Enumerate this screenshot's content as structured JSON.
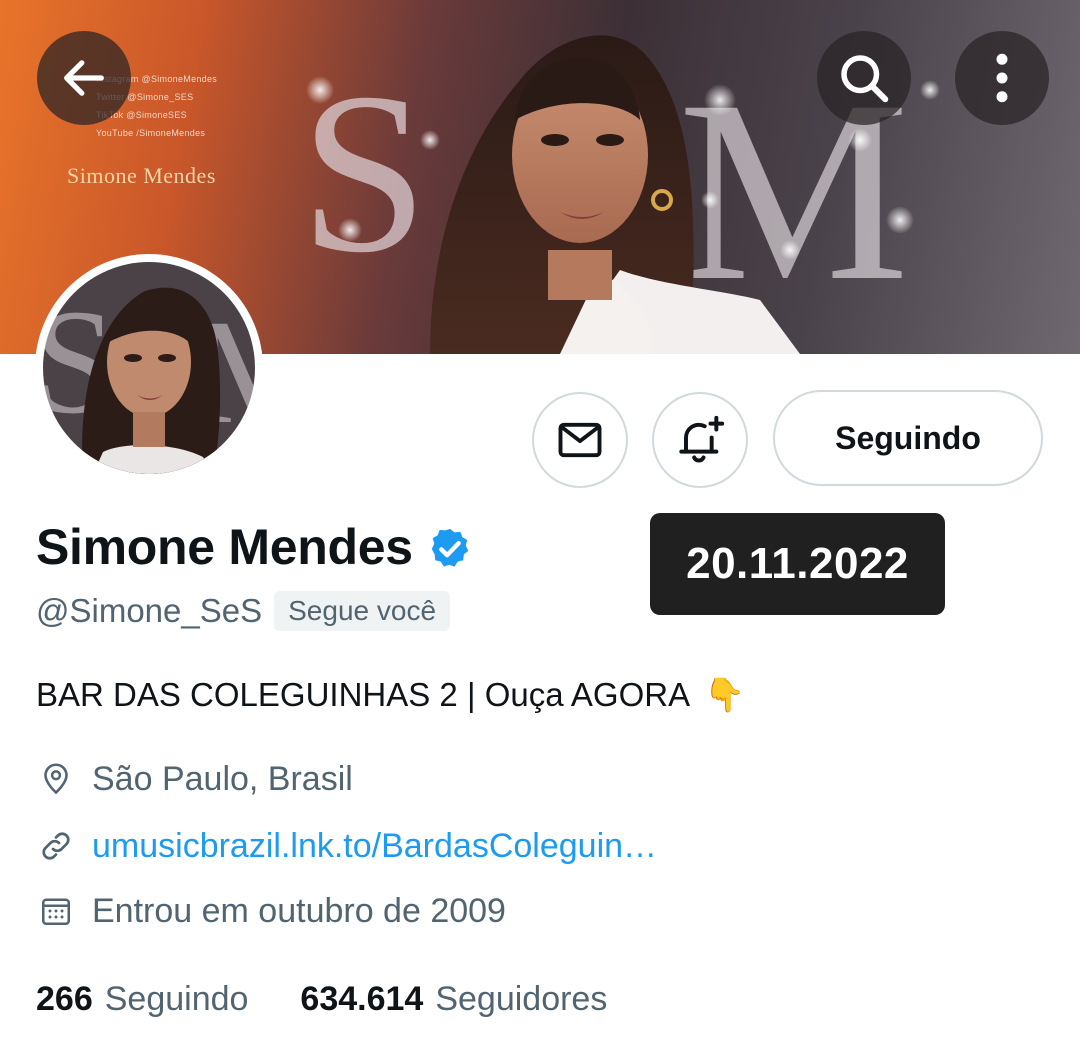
{
  "banner": {
    "socials": [
      "Instagram @SimoneMendes",
      "Twitter @Simone_SES",
      "TikTok @SimoneSES",
      "YouTube /SimoneMendes"
    ],
    "signature": "Simone Mendes",
    "monogram": "SM"
  },
  "toolbar": {
    "back_icon": "arrow-left-icon",
    "search_icon": "search-icon",
    "more_icon": "more-vertical-icon"
  },
  "actions": {
    "message_icon": "envelope-icon",
    "notify_icon": "bell-plus-icon",
    "follow_label": "Seguindo"
  },
  "profile": {
    "name": "Simone Mendes",
    "verified": true,
    "handle": "@Simone_SeS",
    "follows_you": "Segue você",
    "bio": "BAR DAS COLEGUINHAS 2 | Ouça AGORA",
    "bio_emoji": "👇",
    "location": "São Paulo, Brasil",
    "website": "umusicbrazil.lnk.to/BardasColeguin…",
    "joined": "Entrou em outubro de 2009"
  },
  "stats": {
    "following_count": "266",
    "following_label": "Seguindo",
    "followers_count": "634.614",
    "followers_label": "Seguidores"
  },
  "overlay": {
    "date": "20.11.2022"
  },
  "colors": {
    "accent": "#1d9bf0",
    "text_primary": "#0f1419",
    "text_secondary": "#536471",
    "border": "#cfd9de"
  }
}
